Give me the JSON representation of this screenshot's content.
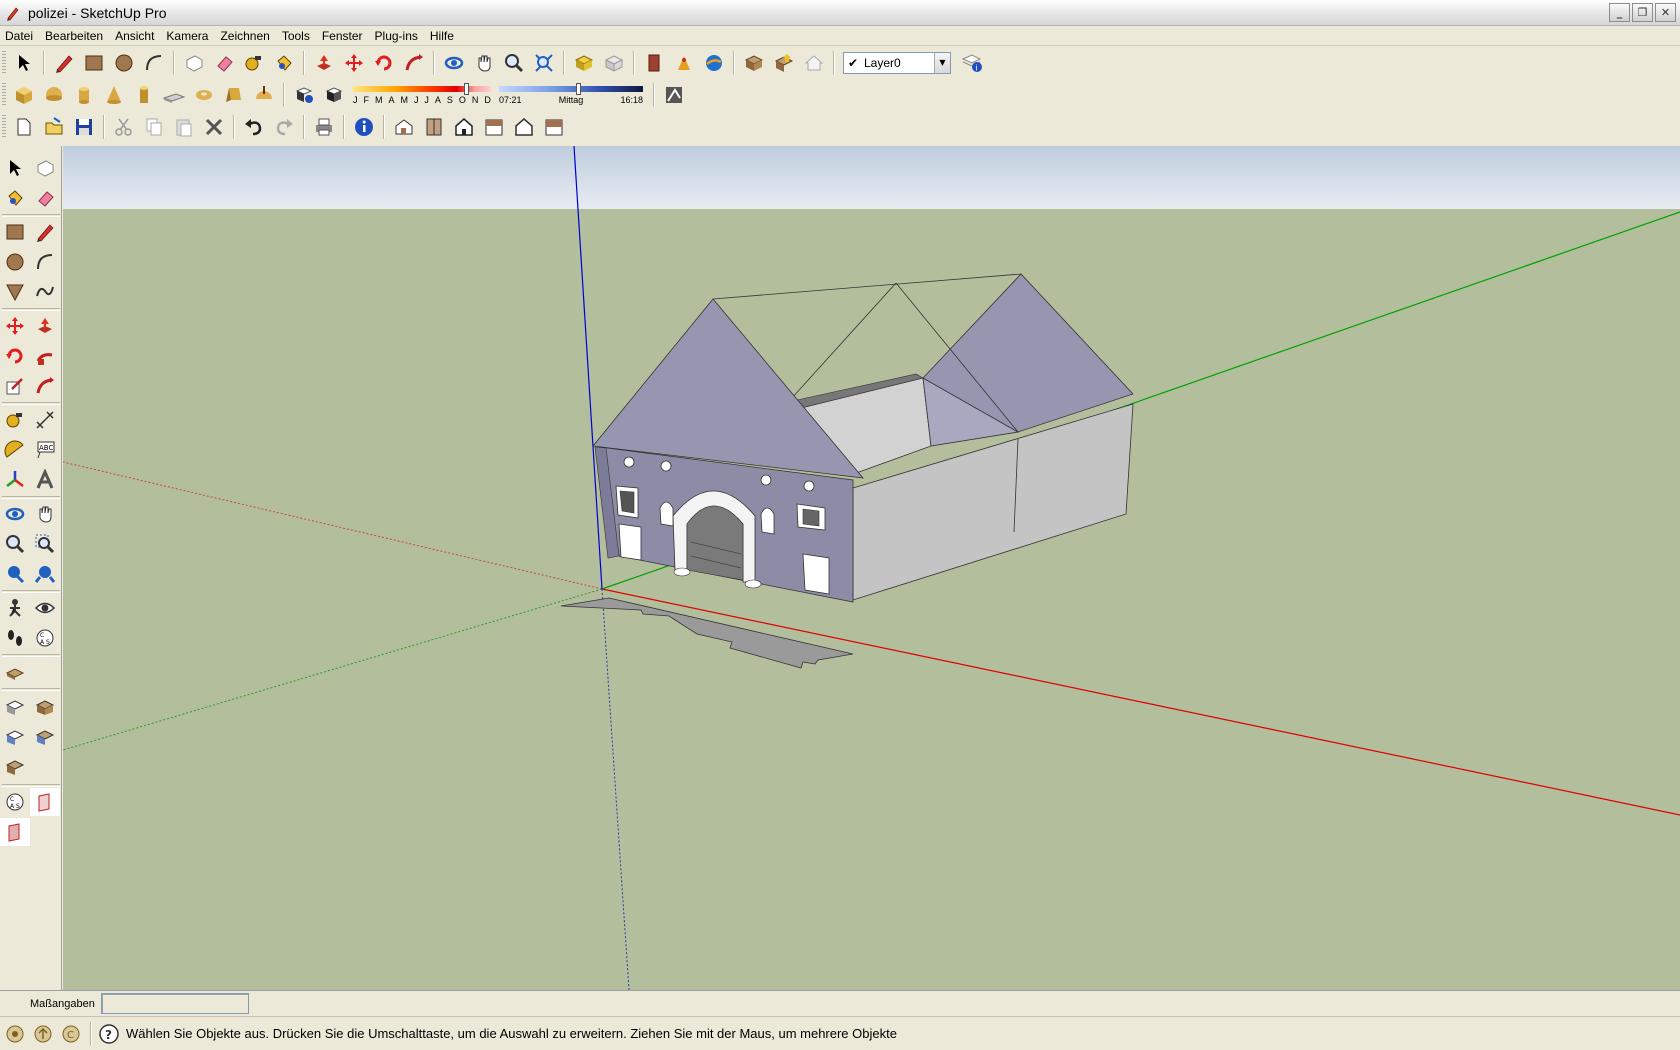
{
  "window": {
    "title": "polizei - SketchUp Pro"
  },
  "menu": [
    "Datei",
    "Bearbeiten",
    "Ansicht",
    "Kamera",
    "Zeichnen",
    "Tools",
    "Fenster",
    "Plug-ins",
    "Hilfe"
  ],
  "layers": {
    "current": "Layer0"
  },
  "shadows": {
    "months": [
      "J",
      "F",
      "M",
      "A",
      "M",
      "J",
      "J",
      "A",
      "S",
      "O",
      "N",
      "D"
    ],
    "sunrise": "07:21",
    "noon": "Mittag",
    "sunset": "16:18",
    "month_position": 0.82,
    "time_position": 0.55
  },
  "measurements": {
    "label": "Maßangaben",
    "value": ""
  },
  "status": {
    "text": "Wählen Sie Objekte aus. Drücken Sie die Umschalttaste, um die Auswahl zu erweitern. Ziehen Sie mit der Maus, um mehrere Objekte"
  },
  "colors": {
    "sky_top": "#bfcddd",
    "ground": "#b3bf9c",
    "facade": "#8c8ca6",
    "roof": "#9696b0",
    "side_wall": "#c4c4c4",
    "x_axis": "#e00000",
    "y_axis": "#00b000",
    "z_axis": "#0000e0"
  }
}
